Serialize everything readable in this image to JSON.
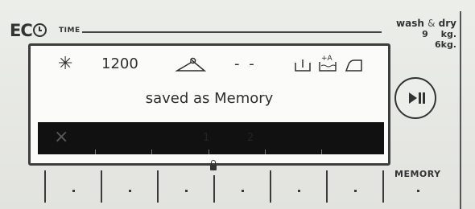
{
  "header": {
    "logo_text": "EC",
    "time_label": "TIME",
    "wash_dry": {
      "wash": "wash",
      "amp": "&",
      "dry": "dry",
      "capacity": "9 kg. 6kg."
    }
  },
  "display": {
    "spin_speed": "1200",
    "timer_placeholder": "- -",
    "message": "saved as Memory",
    "bar_x": "×",
    "bar_faint_1": "1",
    "bar_faint_2": "2"
  },
  "controls": {
    "memory_label": "MEMORY"
  },
  "icons": {
    "temp": "snowflake-icon",
    "dry_hanger": "hanger-icon",
    "end_time": "end-time-icon",
    "extra_rinse": "extra-rinse-icon",
    "iron": "easy-iron-icon",
    "play_pause": "play-pause-icon",
    "lock": "child-lock-icon"
  }
}
